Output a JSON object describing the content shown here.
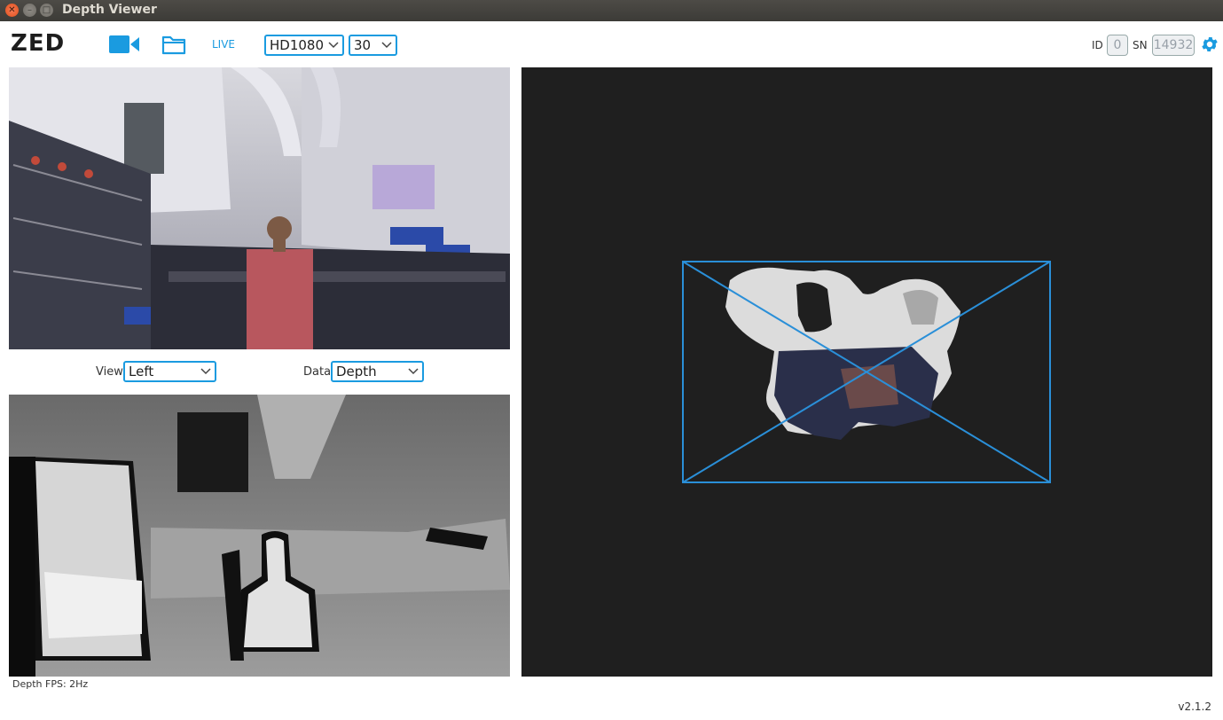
{
  "window": {
    "title": "Depth Viewer"
  },
  "toolbar": {
    "logo": "ZED",
    "live_label": "LIVE",
    "resolution": {
      "selected": "HD1080"
    },
    "fps": {
      "selected": "30"
    },
    "id_label": "ID",
    "id_value": "0",
    "sn_label": "SN",
    "sn_value": "14932"
  },
  "controls": {
    "view_label": "View",
    "view_selected": "Left",
    "data_label": "Data",
    "data_selected": "Depth"
  },
  "status": {
    "depth_fps": "Depth FPS: 2Hz"
  },
  "footer": {
    "version": "v2.1.2"
  },
  "colors": {
    "accent": "#1a9be0",
    "viewer_bg": "#1f1f1f",
    "frustum": "#2a8fd8"
  },
  "icons": [
    "camera-icon",
    "folder-icon",
    "gear-icon",
    "chevron-down-icon",
    "close-icon",
    "minimize-icon",
    "maximize-icon"
  ]
}
